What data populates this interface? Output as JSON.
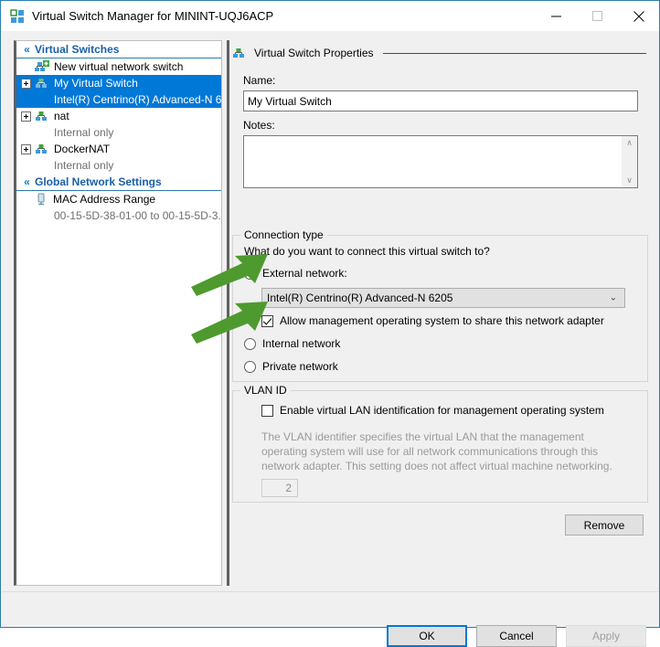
{
  "window": {
    "title": "Virtual Switch Manager for MININT-UQJ6ACP",
    "icon": "virtual-switch-manager-icon",
    "minimize_label": "—",
    "maximize_label": "□",
    "close_label": "✕",
    "accent_color": "#0078d7",
    "titlebar_border_color": "#2b7cb0"
  },
  "tree": {
    "sections": [
      {
        "label": "Virtual Switches",
        "chevron": "«",
        "items": [
          {
            "label": "New virtual network switch",
            "sub": "",
            "expandable": false,
            "selected": false,
            "icon": "new-virtual-switch-icon"
          },
          {
            "label": "My Virtual Switch",
            "sub": "Intel(R) Centrino(R) Advanced-N 6...",
            "expandable": true,
            "selected": true,
            "icon": "virtual-switch-icon"
          },
          {
            "label": "nat",
            "sub": "Internal only",
            "expandable": true,
            "selected": false,
            "icon": "virtual-switch-icon"
          },
          {
            "label": "DockerNAT",
            "sub": "Internal only",
            "expandable": true,
            "selected": false,
            "icon": "virtual-switch-icon"
          }
        ]
      },
      {
        "label": "Global Network Settings",
        "chevron": "«",
        "items": [
          {
            "label": "MAC Address Range",
            "sub": "00-15-5D-38-01-00 to 00-15-5D-3...",
            "expandable": false,
            "selected": false,
            "icon": "mac-address-range-icon"
          }
        ]
      }
    ]
  },
  "properties": {
    "group_title": "Virtual Switch Properties",
    "group_icon": "virtual-switch-icon",
    "name_label": "Name:",
    "name_value": "My Virtual Switch",
    "name_placeholder": "",
    "notes_label": "Notes:",
    "notes_value": "",
    "notes_placeholder": "",
    "scroll_up": "∧",
    "scroll_down": "∨"
  },
  "connection": {
    "group_title": "Connection type",
    "question": "What do you want to connect this virtual switch to?",
    "external_label": "External network:",
    "external_selected": true,
    "adapter_value": "Intel(R) Centrino(R) Advanced-N 6205",
    "adapter_arrow": "⌄",
    "share_label": "Allow management operating system to share this network adapter",
    "share_checked": true,
    "internal_label": "Internal network",
    "internal_selected": false,
    "private_label": "Private network",
    "private_selected": false
  },
  "vlan": {
    "group_title": "VLAN ID",
    "enable_label": "Enable virtual LAN identification for management operating system",
    "enable_checked": false,
    "description": "The VLAN identifier specifies the virtual LAN that the management operating system will use for all network communications through this network adapter. This setting does not affect virtual machine networking.",
    "value": "2",
    "disabled_color": "#9a9a9a"
  },
  "buttons": {
    "remove": "Remove",
    "ok": "OK",
    "cancel": "Cancel",
    "apply": "Apply"
  },
  "annotations": {
    "arrow_color": "#4e9a2f",
    "arrow_1": "green-arrow-pointing-to-external-network-radio",
    "arrow_2": "green-arrow-pointing-to-share-adapter-checkbox"
  }
}
